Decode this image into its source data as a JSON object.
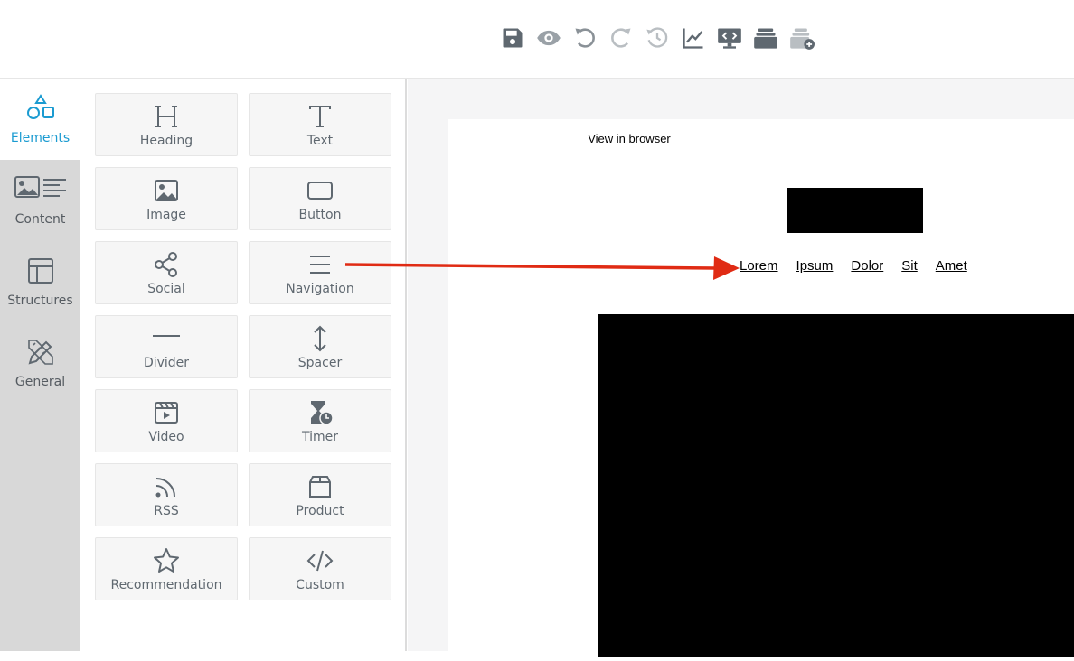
{
  "toolbar": {
    "icons": [
      "save-icon",
      "preview-eye-icon",
      "undo-icon",
      "redo-icon",
      "history-icon",
      "analytics-chart-icon",
      "code-view-monitor-icon",
      "stack-icon",
      "stack-add-icon"
    ]
  },
  "sidebar": {
    "items": [
      {
        "label": "Elements",
        "icon": "shapes-icon",
        "active": true
      },
      {
        "label": "Content",
        "icon": "content-blocks-icon",
        "active": false
      },
      {
        "label": "Structures",
        "icon": "layout-icon",
        "active": false
      },
      {
        "label": "General",
        "icon": "pencil-ruler-icon",
        "active": false
      }
    ]
  },
  "elements": {
    "tiles": [
      {
        "label": "Heading",
        "icon": "heading-icon"
      },
      {
        "label": "Text",
        "icon": "text-icon"
      },
      {
        "label": "Image",
        "icon": "image-icon"
      },
      {
        "label": "Button",
        "icon": "button-icon"
      },
      {
        "label": "Social",
        "icon": "share-icon"
      },
      {
        "label": "Navigation",
        "icon": "menu-icon"
      },
      {
        "label": "Divider",
        "icon": "divider-icon"
      },
      {
        "label": "Spacer",
        "icon": "spacer-icon"
      },
      {
        "label": "Video",
        "icon": "video-icon"
      },
      {
        "label": "Timer",
        "icon": "timer-icon"
      },
      {
        "label": "RSS",
        "icon": "rss-icon"
      },
      {
        "label": "Product",
        "icon": "product-box-icon"
      },
      {
        "label": "Recommendation",
        "icon": "star-icon"
      },
      {
        "label": "Custom",
        "icon": "code-icon"
      }
    ]
  },
  "email": {
    "view_in_browser": "View in browser",
    "nav_links": [
      "Lorem",
      "Ipsum",
      "Dolor",
      "Sit",
      "Amet"
    ]
  },
  "colors": {
    "accent": "#1b9bd1",
    "icon_gray": "#5f6870",
    "arrow_red": "#e02b14",
    "sidebar_bg": "#d8d8d8"
  }
}
